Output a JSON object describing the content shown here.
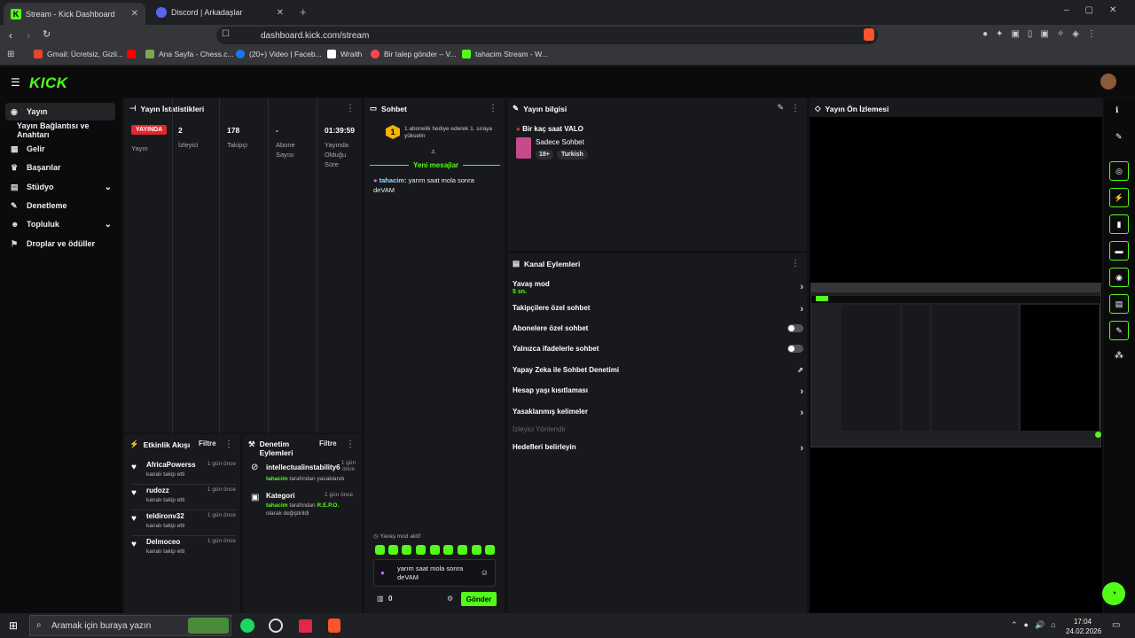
{
  "browser": {
    "tabs": [
      {
        "label": "Stream - Kick Dashboard",
        "active": true
      },
      {
        "label": "Discord | Arkadaşlar",
        "active": false
      }
    ],
    "url": "dashboard.kick.com/stream",
    "bookmarks": [
      "Gmail: Ücretsiz, Gizli...",
      "Ana Sayfa - Chess.c...",
      "(20+) Video | Faceb...",
      "Wraith",
      "Bir talep gönder – V...",
      "tahacim Stream - W..."
    ]
  },
  "brand": {
    "logo": "KICK",
    "accent": "#53fc18"
  },
  "sidebar": {
    "items": [
      {
        "label": "Yayın",
        "icon": "stream-icon"
      },
      {
        "label": "Yayın Bağlantısı ve Anahtarı",
        "icon": ""
      },
      {
        "label": "Gelir",
        "icon": "revenue-icon"
      },
      {
        "label": "Başarılar",
        "icon": "trophy-icon"
      },
      {
        "label": "Stüdyo",
        "icon": "studio-icon"
      },
      {
        "label": "Denetleme",
        "icon": "wrench-icon"
      },
      {
        "label": "Topluluk",
        "icon": "community-icon"
      },
      {
        "label": "Droplar ve ödüller",
        "icon": "gift-icon"
      }
    ]
  },
  "stats": {
    "title": "Yayın İstatistikleri",
    "live_badge": "YAYINDA",
    "live_label": "Yayın",
    "items": [
      {
        "value": "2",
        "label": "İzleyici"
      },
      {
        "value": "178",
        "label": "Takipçi"
      },
      {
        "value": "-",
        "label": "Abone Sayısı"
      },
      {
        "value": "01:39:59",
        "label": "Yayında Olduğu Süre"
      }
    ]
  },
  "activity": {
    "title": "Etkinlik Akışı",
    "filter": "Filtre",
    "items": [
      {
        "name": "AfricaPowerss",
        "desc": "kanalı takip etti",
        "time": "1 gün önce"
      },
      {
        "name": "rudozz",
        "desc": "kanalı takip etti",
        "time": "1 gün önce"
      },
      {
        "name": "teldironv32",
        "desc": "kanalı takip etti",
        "time": "1 gün önce"
      },
      {
        "name": "Delmoceo",
        "desc": "kanalı takip etti",
        "time": "1 gün önce"
      }
    ]
  },
  "moderation": {
    "title": "Denetim Eylemleri",
    "filter": "Filtre",
    "items": [
      {
        "name": "intellectualinstability6",
        "by": "tahacim",
        "rest": "tarafından yasaklandı",
        "time": "1 gün önce"
      },
      {
        "name": "Kategori",
        "by": "tahacim",
        "rest": "tarafından",
        "hl": "R.E.P.O.",
        "rest2": "olarak değiştirildi",
        "time": "1 gün önce"
      }
    ]
  },
  "chat": {
    "title": "Sohbet",
    "gift_rank": "1",
    "gift_text": "1 abonelik hediye ederek 1. sıraya yükselin",
    "new_messages": "Yeni mesajlar",
    "msg_user": "tahacim:",
    "msg_text": "yarım saat mola sonra deVAM",
    "slow_mode": "Yavaş mod aktif",
    "input_value": "yarım saat mola sonra deVAM",
    "count": "0",
    "send": "Gönder"
  },
  "streaminfo": {
    "title": "Yayın bilgisi",
    "stream_title": "Bir kaç saat VALO",
    "category": "Sadece Sohbet",
    "tags": [
      "18+",
      "Turkish"
    ]
  },
  "channel": {
    "title": "Kanal Eylemleri",
    "slow_mode": "Yavaş mod",
    "slow_value": "5 sn.",
    "rows": [
      "Takipçilere özel sohbet",
      "Abonelere özel sohbet",
      "Yalnızca ifadelerle sohbet",
      "Yapay Zeka ile Sohbet Denetimi",
      "Hesap yaşı kısıtlaması",
      "Yasaklanmış kelimeler",
      "İzleyici Yönlendir",
      "Hedefleri belirleyin"
    ]
  },
  "preview": {
    "title": "Yayın Ön İzlemesi"
  },
  "taskbar": {
    "search_placeholder": "Aramak için buraya yazın",
    "time": "17:04",
    "date": "24.02.2026"
  }
}
